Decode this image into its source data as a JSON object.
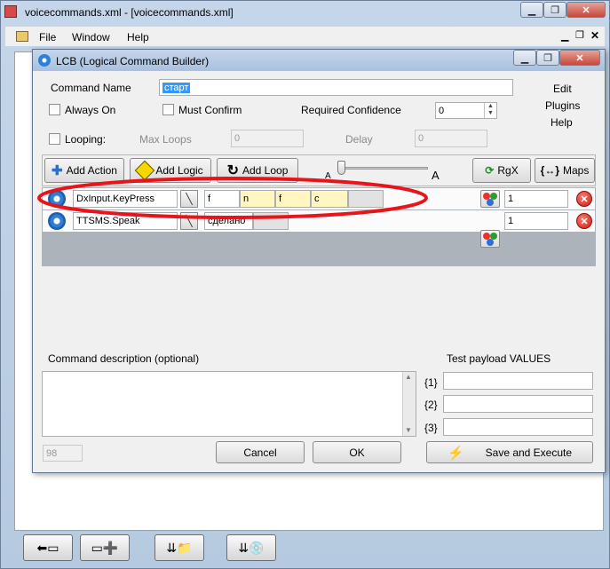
{
  "outer": {
    "title": "voicecommands.xml - [voicecommands.xml]",
    "menu": [
      "File",
      "Window",
      "Help"
    ],
    "caption_buttons": [
      "minimize-icon",
      "restore-icon",
      "close-icon"
    ]
  },
  "dialog": {
    "title": "LCB (Logical Command Builder)",
    "command_name_label": "Command Name",
    "command_name_value": "старт",
    "always_on_label": "Always On",
    "must_confirm_label": "Must Confirm",
    "required_confidence_label": "Required Confidence",
    "required_confidence_value": "0",
    "looping_label": "Looping:",
    "max_loops_label": "Max Loops",
    "max_loops_value": "0",
    "delay_label": "Delay",
    "delay_value": "0",
    "side_links": [
      "Edit",
      "Plugins",
      "Help"
    ],
    "toolbar": {
      "add_action": "Add Action",
      "add_logic": "Add Logic",
      "add_loop": "Add Loop",
      "slider_left": "A",
      "slider_right": "A",
      "rgx": "RgX",
      "maps": "Maps"
    },
    "actions": [
      {
        "name": "DxInput.KeyPress",
        "params": [
          "f",
          "n",
          "f",
          "c",
          ""
        ],
        "count": "1"
      },
      {
        "name": "TTSMS.Speak",
        "params": [
          "сделано",
          ""
        ],
        "count": "1"
      }
    ],
    "description_label": "Command description (optional)",
    "test_payload_label": "Test payload VALUES",
    "payload_slots": [
      "{1}",
      "{2}",
      "{3}"
    ],
    "status_value": "98",
    "cancel_label": "Cancel",
    "ok_label": "OK",
    "save_execute_label": "Save and Execute"
  },
  "annotation": {
    "color": "#e8141a"
  }
}
